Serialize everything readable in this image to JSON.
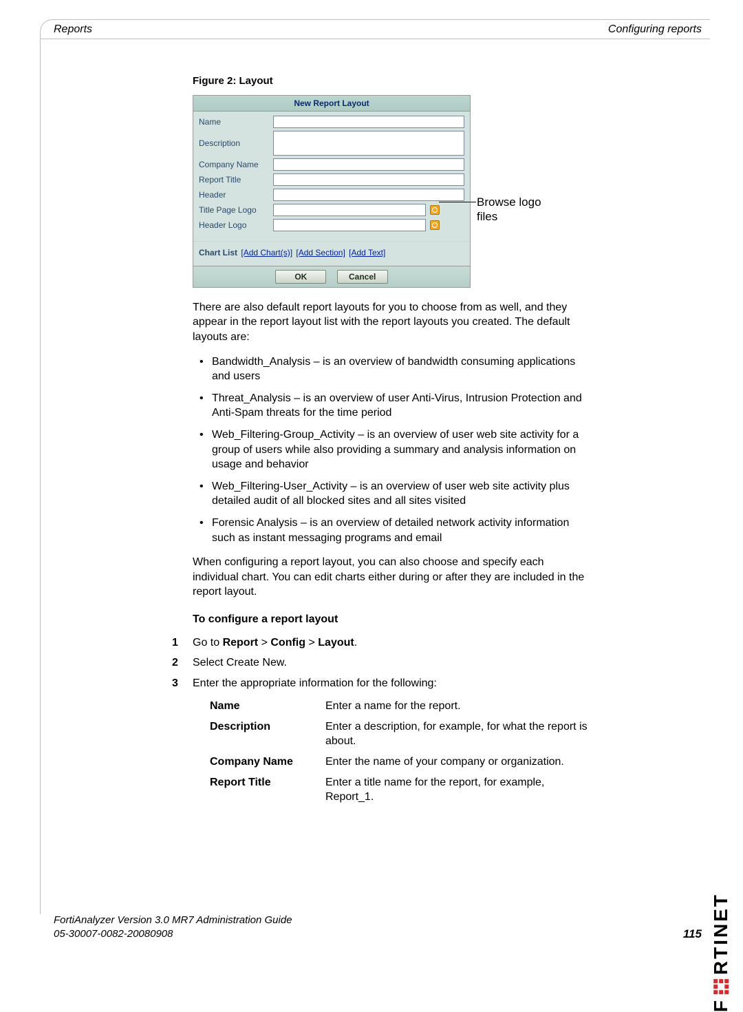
{
  "header": {
    "left": "Reports",
    "right": "Configuring reports"
  },
  "figure": {
    "caption": "Figure 2:   Layout",
    "annotation": "Browse logo files"
  },
  "screenshot": {
    "title": "New Report Layout",
    "fields": {
      "name": "Name",
      "description": "Description",
      "company_name": "Company Name",
      "report_title": "Report Title",
      "header": "Header",
      "title_page_logo": "Title Page Logo",
      "header_logo": "Header Logo"
    },
    "chartlist_label": "Chart List",
    "links": {
      "add_charts": "[Add Chart(s)]",
      "add_section": "[Add Section]",
      "add_text": "[Add Text]"
    },
    "buttons": {
      "ok": "OK",
      "cancel": "Cancel"
    }
  },
  "body": {
    "intro": "There are also default report layouts for you to choose from as well, and they appear in the report layout list with the report layouts you created. The default layouts are:",
    "bullets": [
      "Bandwidth_Analysis – is an overview of bandwidth consuming applications and users",
      "Threat_Analysis – is an overview of user Anti-Virus, Intrusion Protection and Anti-Spam threats for the time period",
      "Web_Filtering-Group_Activity – is an overview of user web site activity for a group of users while also providing a summary and analysis information on usage and behavior",
      "Web_Filtering-User_Activity – is an overview of user web site activity plus detailed audit of all blocked sites and all sites visited",
      "Forensic Analysis – is an overview of detailed network activity information such as instant messaging programs and email"
    ],
    "after_list": "When configuring a report layout, you can also choose and specify each individual chart. You can edit charts either during or after they are included in the report layout.",
    "subhead": "To configure a report layout",
    "steps": {
      "s1_pre": "Go to ",
      "s1_b1": "Report",
      "s1_b2": "Config",
      "s1_b3": "Layout",
      "s2": "Select Create New.",
      "s3": "Enter the appropriate information for the following:"
    },
    "defs": {
      "name_t": "Name",
      "name_d": "Enter a name for the report.",
      "desc_t": "Description",
      "desc_d": "Enter a description, for example, for what the report is about.",
      "comp_t": "Company Name",
      "comp_d": "Enter the name of your company or organization.",
      "title_t": "Report Title",
      "title_d": "Enter a title name for the report, for example, Report_1."
    }
  },
  "footer": {
    "line1": "FortiAnalyzer Version 3.0 MR7 Administration Guide",
    "line2": "05-30007-0082-20080908",
    "page": "115"
  },
  "brand": "RTINET"
}
